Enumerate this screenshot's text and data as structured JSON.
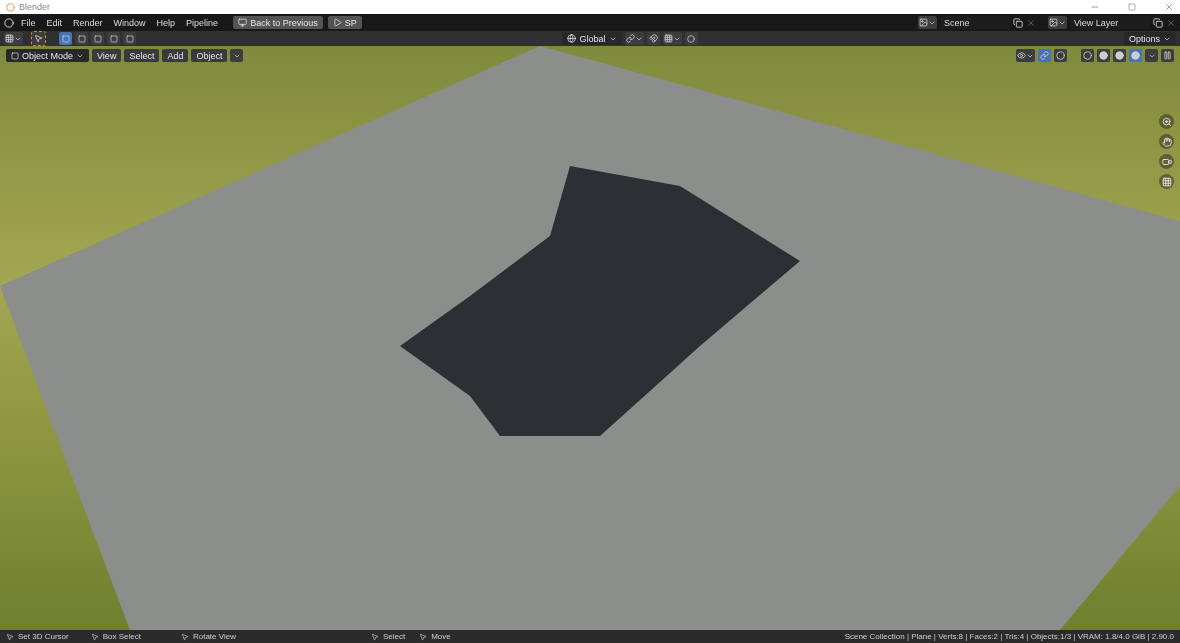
{
  "window": {
    "title": "Blender"
  },
  "menu": [
    "File",
    "Edit",
    "Render",
    "Window",
    "Help",
    "Pipeline"
  ],
  "workspace_buttons": [
    {
      "label": "Back to Previous"
    },
    {
      "label": "SP"
    }
  ],
  "scene": {
    "value": "Scene"
  },
  "view_layer": {
    "value": "View Layer"
  },
  "tool_header": {
    "select_modes": [
      {
        "selected": true
      },
      {
        "selected": false
      },
      {
        "selected": false
      },
      {
        "selected": false
      },
      {
        "selected": false
      }
    ],
    "orientation": "Global",
    "options": "Options"
  },
  "viewport": {
    "mode": "Object Mode",
    "menus": [
      "View",
      "Select",
      "Add",
      "Object"
    ],
    "shading_modes": [
      {
        "selected": false
      },
      {
        "selected": false
      },
      {
        "selected": false
      },
      {
        "selected": true
      }
    ]
  },
  "status_bar": {
    "hints": [
      "Set 3D Cursor",
      "Box Select",
      "Rotate View",
      "Select",
      "Move"
    ],
    "stats": "Scene Collection | Plane | Verts:8 | Faces:2 | Tris:4 | Objects:1/3 | VRAM: 1.8/4.0 GiB | 2.90.0"
  }
}
